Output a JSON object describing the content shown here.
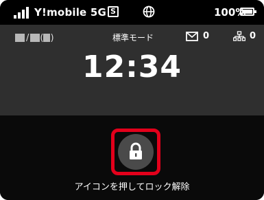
{
  "status_bar": {
    "carrier": "Y!mobile 5G",
    "sim_label": "S",
    "battery": "100%",
    "signal_icon": "signal-bars-icon",
    "globe_icon": "globe-icon",
    "battery_icon": "battery-icon"
  },
  "info_bar": {
    "date_separator": "/",
    "date_paren_open": "(",
    "date_paren_close": ")",
    "mode": "標準モード",
    "mail_count": "0",
    "network_count": "0",
    "mail_icon": "mail-icon",
    "network_icon": "network-devices-icon"
  },
  "clock": {
    "time": "12:34"
  },
  "lock": {
    "icon": "lock-icon",
    "hint": "アイコンを押してロック解除"
  },
  "colors": {
    "highlight": "#e3001b",
    "panel": "#2f2f2f",
    "background": "#0a0a0a"
  }
}
